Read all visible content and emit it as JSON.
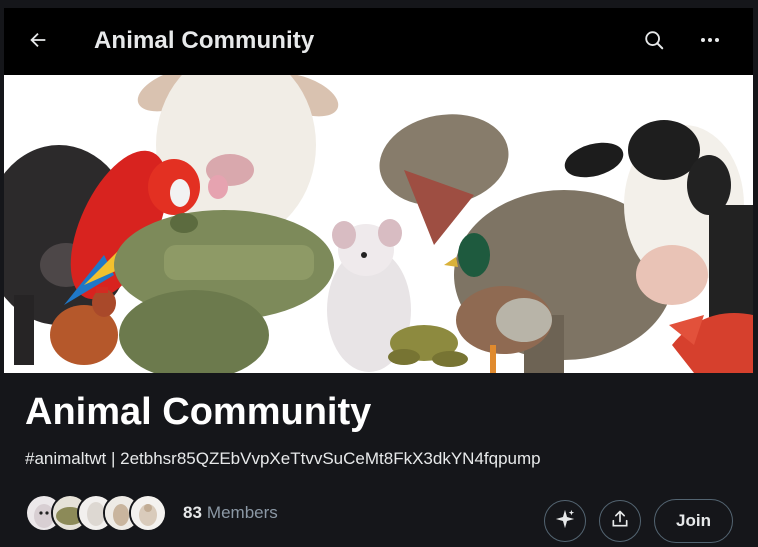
{
  "header": {
    "title": "Animal Community",
    "back_icon": "arrow-left-icon",
    "search_icon": "search-icon",
    "more_icon": "more-horizontal-icon"
  },
  "banner": {
    "description": "Collage of animals: pig, macaw, sheep, crocodile, rat, frog, duck, hen, T-rex, cow, lobster"
  },
  "community": {
    "name": "Animal Community",
    "description": "#animaltwt | 2etbhsr85QZEbVvpXeTtvvSuCeMt8FkX3dkYN4fqpump",
    "member_count": "83",
    "member_label": "Members",
    "join_label": "Join"
  },
  "actions": {
    "grok_icon": "sparkle-icon",
    "share_icon": "share-icon"
  },
  "colors": {
    "background": "#15161a",
    "topbar": "#000000",
    "text": "#e7e9ea",
    "muted": "#8b98a5",
    "border": "#536471"
  }
}
